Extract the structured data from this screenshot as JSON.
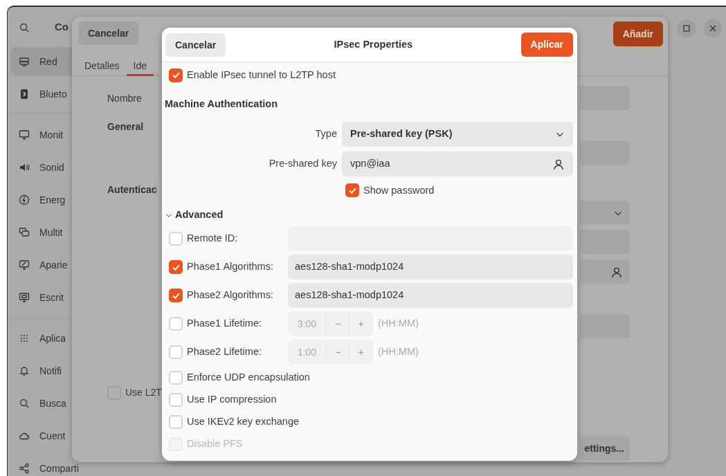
{
  "sidebar": {
    "title": "Co",
    "items": [
      {
        "label": "Red",
        "selected": true
      },
      {
        "label": "Blueto",
        "selected": false
      },
      {
        "label": "Monit",
        "selected": false
      },
      {
        "label": "Sonid",
        "selected": false
      },
      {
        "label": "Energ",
        "selected": false
      },
      {
        "label": "Multit",
        "selected": false
      },
      {
        "label": "Aparie",
        "selected": false
      },
      {
        "label": "Escrit",
        "selected": false
      },
      {
        "label": "Aplica",
        "selected": false
      },
      {
        "label": "Notifi",
        "selected": false
      },
      {
        "label": "Busca",
        "selected": false
      },
      {
        "label": "Cuent",
        "selected": false
      },
      {
        "label": "Comparti",
        "selected": false
      }
    ]
  },
  "connection_dialog": {
    "cancel": "Cancelar",
    "add": "Añadir",
    "tabs": [
      {
        "label": "Detalles",
        "selected": false
      },
      {
        "label": "Ide",
        "selected": true
      }
    ],
    "name_label": "Nombre",
    "sections": [
      "General",
      "Autenticac"
    ],
    "l2tp_option": {
      "label": "Use L2T",
      "checked": false
    },
    "settings_button": "ettings..."
  },
  "ipsec_dialog": {
    "title": "IPsec Properties",
    "cancel": "Cancelar",
    "apply": "Aplicar",
    "enable": {
      "label": "Enable IPsec tunnel to L2TP host",
      "checked": true
    },
    "machine_auth_heading": "Machine Authentication",
    "type": {
      "label": "Type",
      "value": "Pre-shared key (PSK)"
    },
    "psk": {
      "label": "Pre-shared key",
      "value": "vpn@iaa"
    },
    "show_password": {
      "label": "Show password",
      "checked": true
    },
    "advanced": {
      "label": "Advanced",
      "expanded": true
    },
    "options": [
      {
        "kind": "text",
        "label": "Remote ID:",
        "checked": false,
        "disabled": false
      },
      {
        "kind": "text",
        "label": "Phase1 Algorithms:",
        "checked": true,
        "disabled": false,
        "value": "aes128-sha1-modp1024"
      },
      {
        "kind": "text",
        "label": "Phase2 Algorithms:",
        "checked": true,
        "disabled": false,
        "value": "aes128-sha1-modp1024"
      },
      {
        "kind": "spin",
        "label": "Phase1 Lifetime:",
        "checked": false,
        "disabled": false,
        "value": "3:00",
        "minus": "−",
        "plus": "+",
        "unit": "(HH:MM)"
      },
      {
        "kind": "spin",
        "label": "Phase2 Lifetime:",
        "checked": false,
        "disabled": false,
        "value": "1:00",
        "minus": "−",
        "plus": "+",
        "unit": "(HH:MM)"
      },
      {
        "kind": "check",
        "label": "Enforce UDP encapsulation",
        "checked": false,
        "disabled": false
      },
      {
        "kind": "check",
        "label": "Use IP compression",
        "checked": false,
        "disabled": false
      },
      {
        "kind": "check",
        "label": "Use IKEv2 key exchange",
        "checked": false,
        "disabled": false
      },
      {
        "kind": "check",
        "label": "Disable PFS",
        "checked": false,
        "disabled": true
      }
    ]
  }
}
